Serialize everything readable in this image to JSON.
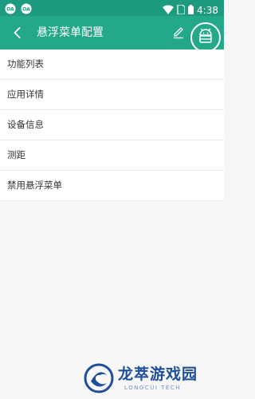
{
  "status_bar": {
    "time": "4:38",
    "icons": [
      "notification-icon",
      "notification-icon",
      "wifi-icon",
      "sim-icon",
      "battery-icon"
    ]
  },
  "app_bar": {
    "title": "悬浮菜单配置",
    "icons": [
      "back-arrow-icon",
      "edit-icon",
      "android-robot-icon"
    ]
  },
  "menu": {
    "items": [
      {
        "label": "功能列表"
      },
      {
        "label": "应用详情"
      },
      {
        "label": "设备信息"
      },
      {
        "label": "测距"
      },
      {
        "label": "禁用悬浮菜单"
      }
    ]
  },
  "watermark": {
    "title": "龙萃游戏园",
    "subtitle": "LONGCUI TECH"
  },
  "colors": {
    "status_bar": "#1e9b7e",
    "app_bar": "#23a98a",
    "background": "#f7f7f7",
    "watermark": "#1f4e9a"
  }
}
